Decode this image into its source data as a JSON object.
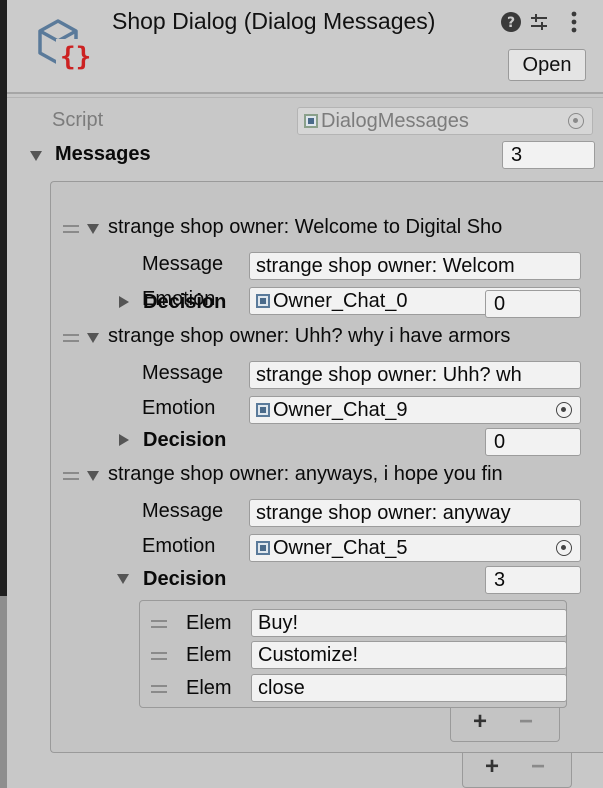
{
  "header": {
    "title": "Shop Dialog (Dialog Messages)",
    "open_label": "Open",
    "icons": [
      "script-object-icon",
      "help-icon",
      "settings-icon",
      "menu-icon"
    ]
  },
  "script_row": {
    "label": "Script",
    "value": "DialogMessages"
  },
  "messages": {
    "label": "Messages",
    "count": "3",
    "items": [
      {
        "header": "strange shop owner: Welcome to Digital Sho",
        "message_label": "Message",
        "message_value": "strange shop owner: Welcom",
        "emotion_label": "Emotion",
        "emotion_value": "Owner_Chat_0",
        "decision_label": "Decision",
        "decision_count": "0"
      },
      {
        "header": "strange shop owner: Uhh? why i have armors",
        "message_label": "Message",
        "message_value": "strange shop owner: Uhh? wh",
        "emotion_label": "Emotion",
        "emotion_value": "Owner_Chat_9",
        "decision_label": "Decision",
        "decision_count": "0"
      },
      {
        "header": "strange shop owner: anyways, i hope you fin",
        "message_label": "Message",
        "message_value": "strange shop owner: anyway",
        "emotion_label": "Emotion",
        "emotion_value": "Owner_Chat_5",
        "decision_label": "Decision",
        "decision_count": "3",
        "decision_elements": [
          {
            "label": "Elem",
            "value": "Buy!"
          },
          {
            "label": "Elem",
            "value": "Customize!"
          },
          {
            "label": "Elem",
            "value": "close"
          }
        ]
      }
    ]
  },
  "list_controls": {
    "plus": "+",
    "minus": "−"
  },
  "colors": {
    "background": "#c8c8c8",
    "field": "#f2f2f2",
    "code_braces": "#cc2222",
    "object_icon": "#5a7a9a"
  }
}
